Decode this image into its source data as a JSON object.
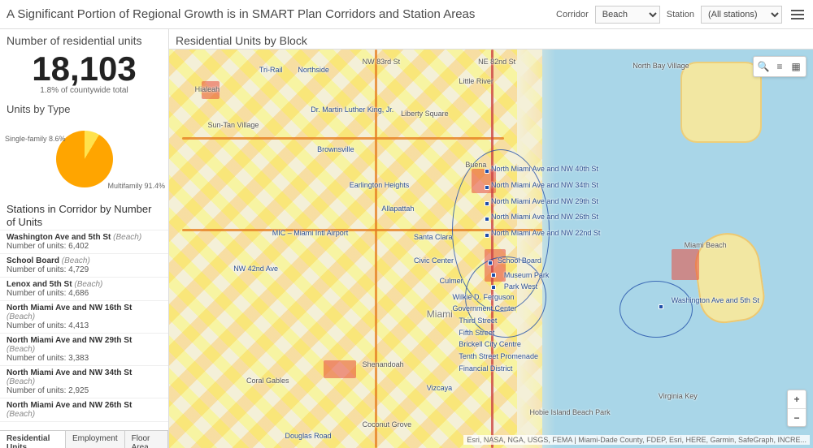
{
  "header": {
    "title": "A Significant Portion of Regional Growth is in SMART Plan Corridors and Station Areas",
    "corridor_label": "Corridor",
    "corridor_value": "Beach",
    "station_label": "Station",
    "station_value": "(All stations)"
  },
  "kpi": {
    "title": "Number of residential units",
    "value": "18,103",
    "subtitle": "1.8% of countywide total"
  },
  "chart_data": {
    "type": "pie",
    "title": "Units by Type",
    "series": [
      {
        "name": "Single-family",
        "value": 8.6
      },
      {
        "name": "Multifamily",
        "value": 91.4
      }
    ]
  },
  "pie_labels": {
    "single_family": "Single-family 8.6%",
    "multifamily": "Multifamily 91.4%"
  },
  "station_list": {
    "title": "Stations in Corridor by Number of Units",
    "units_prefix": "Number of units: ",
    "items": [
      {
        "name": "Washington Ave and 5th St",
        "corridor": "Beach",
        "units": "6,402"
      },
      {
        "name": "School Board",
        "corridor": "Beach",
        "units": "4,729"
      },
      {
        "name": "Lenox and 5th St",
        "corridor": "Beach",
        "units": "4,686"
      },
      {
        "name": "North Miami Ave and NW 16th St",
        "corridor": "Beach",
        "units": "4,413"
      },
      {
        "name": "North Miami Ave and NW 29th St",
        "corridor": "Beach",
        "units": "3,383"
      },
      {
        "name": "North Miami Ave and NW 34th St",
        "corridor": "Beach",
        "units": "2,925"
      },
      {
        "name": "North Miami Ave and NW 26th St",
        "corridor": "Beach",
        "units": ""
      }
    ]
  },
  "tabs": {
    "residential": "Residential Units",
    "employment": "Employment",
    "floor_area": "Floor Area"
  },
  "map": {
    "title": "Residential Units by Block",
    "attribution": "Esri, NASA, NGA, USGS, FEMA | Miami-Dade County, FDEP, Esri, HERE, Garmin, SafeGraph, INCRE...",
    "places": {
      "hialeah": "Hialeah",
      "tri_rail": "Tri-Rail",
      "northside": "Northside",
      "nw_83rd": "NW 83rd St",
      "ne_82nd": "NE 82nd St",
      "little_river": "Little River",
      "north_bay_village": "North Bay Village",
      "mlk": "Dr. Martin Luther King, Jr.",
      "liberty_city": "Liberty Square",
      "sun_tan": "Sun-Tan Village",
      "brownsville": "Brownsville",
      "earlington": "Earlington Heights",
      "allapattah": "Allapattah",
      "mic_airport": "MIC – Miami Intl Airport",
      "santa_clara": "Santa Clara",
      "civic_center": "Civic Center",
      "culmer": "Culmer",
      "nw_42nd": "NW 42nd Ave",
      "coral_gables": "Coral Gables",
      "shenandoah": "Shenandoah",
      "vizcaya": "Vizcaya",
      "coconut_grove": "Coconut Grove",
      "douglas": "Douglas Road",
      "miami_beach": "Miami Beach",
      "virginia_key": "Virginia Key",
      "hobie_island": "Hobie Island Beach Park",
      "miami": "Miami",
      "buena": "Buena"
    },
    "stations": {
      "nm_40": "North Miami Ave and NW 40th St",
      "nm_34": "North Miami Ave and NW 34th St",
      "nm_29": "North Miami Ave and NW 29th St",
      "nm_26": "North Miami Ave and NW 26th St",
      "nm_22": "North Miami Ave and NW 22nd St",
      "school_board": "School Board",
      "museum_park": "Museum Park",
      "park_west": "Park West",
      "wilkie": "Wilkie D. Ferguson",
      "gov_center": "Government Center",
      "third": "Third Street",
      "fifth": "Fifth Street",
      "brickell_cc": "Brickell City Centre",
      "tenth": "Tenth Street Promenade",
      "financial": "Financial District",
      "washington_5th": "Washington Ave and 5th St"
    }
  }
}
